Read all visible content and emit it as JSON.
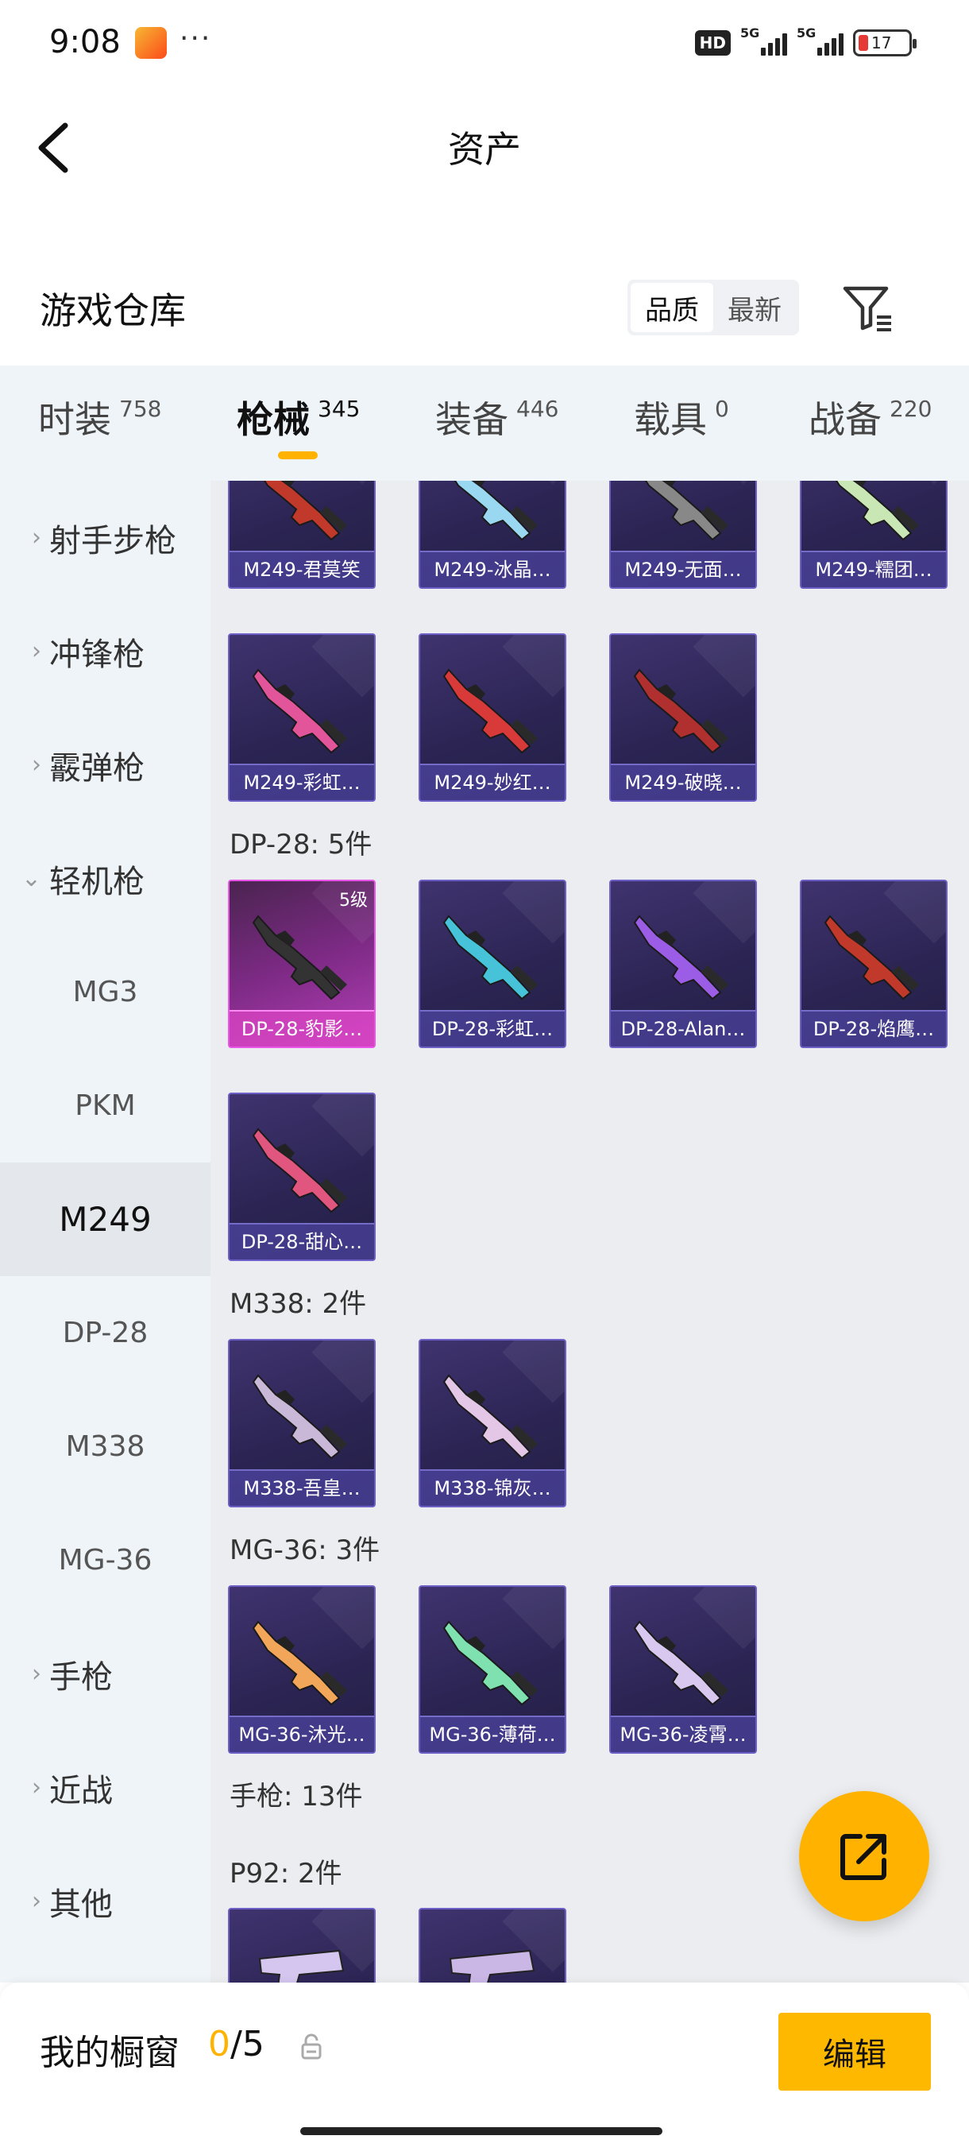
{
  "status_bar": {
    "time": "9:08",
    "dots": "···",
    "hd": "HD",
    "signal1": "5G",
    "signal2": "5G",
    "battery": "17"
  },
  "header": {
    "title": "资产"
  },
  "warehouse": {
    "title": "游戏仓库",
    "sort_options": [
      "品质",
      "最新"
    ],
    "active_sort": "品质"
  },
  "tabs": [
    {
      "label": "时装",
      "count": "758"
    },
    {
      "label": "枪械",
      "count": "345"
    },
    {
      "label": "装备",
      "count": "446"
    },
    {
      "label": "载具",
      "count": "0"
    },
    {
      "label": "战备",
      "count": "220"
    }
  ],
  "active_tab": "枪械",
  "sidebar": {
    "items": [
      {
        "label": "射手步枪",
        "chevron": "›"
      },
      {
        "label": "冲锋枪",
        "chevron": "›"
      },
      {
        "label": "霰弹枪",
        "chevron": "›"
      },
      {
        "label": "轻机枪",
        "chevron": "⌄"
      },
      {
        "label": "MG3"
      },
      {
        "label": "PKM"
      },
      {
        "label": "M249"
      },
      {
        "label": "DP-28"
      },
      {
        "label": "M338"
      },
      {
        "label": "MG-36"
      },
      {
        "label": "手枪",
        "chevron": "›"
      },
      {
        "label": "近战",
        "chevron": "›"
      },
      {
        "label": "其他",
        "chevron": "›"
      }
    ],
    "selected": "M249"
  },
  "content": {
    "m249_cards": [
      {
        "name": "M249-君莫笑",
        "tint": "#c0392b"
      },
      {
        "name": "M249-冰晶…",
        "tint": "#9ad7f0"
      },
      {
        "name": "M249-无面…",
        "tint": "#888888"
      },
      {
        "name": "M249-糯团…",
        "tint": "#c9e6b5"
      },
      {
        "name": "M249-彩虹…",
        "tint": "#e2559a"
      },
      {
        "name": "M249-妙红…",
        "tint": "#d83a3a"
      },
      {
        "name": "M249-破晓…",
        "tint": "#b03030"
      }
    ],
    "groups": {
      "dp28": "DP-28: 5件",
      "m338": "M338: 2件",
      "mg36": "MG-36: 3件",
      "pistol": "手枪: 13件",
      "p92": "P92: 2件"
    },
    "dp28_cards": [
      {
        "name": "DP-28-豹影…",
        "tint": "#333333",
        "level": "5级",
        "rarity": "legendary"
      },
      {
        "name": "DP-28-彩虹…",
        "tint": "#46c3d8"
      },
      {
        "name": "DP-28-Alan…",
        "tint": "#9b5de5"
      },
      {
        "name": "DP-28-焰鹰…",
        "tint": "#c0392b"
      },
      {
        "name": "DP-28-甜心…",
        "tint": "#e0567f"
      }
    ],
    "m338_cards": [
      {
        "name": "M338-吾皇…",
        "tint": "#c9b8d8"
      },
      {
        "name": "M338-锦灰…",
        "tint": "#e4c7e6"
      }
    ],
    "mg36_cards": [
      {
        "name": "MG-36-沐光…",
        "tint": "#f2a65a"
      },
      {
        "name": "MG-36-薄荷…",
        "tint": "#7fe0b0"
      },
      {
        "name": "MG-36-凌霄…",
        "tint": "#d8c8f0"
      }
    ],
    "p92_cards": [
      {
        "name": "",
        "tint": "#d4c6ef"
      },
      {
        "name": "",
        "tint": "#cbb7e6"
      }
    ]
  },
  "bottom": {
    "showcase_label": "我的橱窗",
    "showcase_current": "0",
    "showcase_total": "/5",
    "edit_label": "编辑"
  },
  "colors": {
    "accent": "#ffb200",
    "card_bg": "#2c2554",
    "legendary": "#e855e8"
  }
}
